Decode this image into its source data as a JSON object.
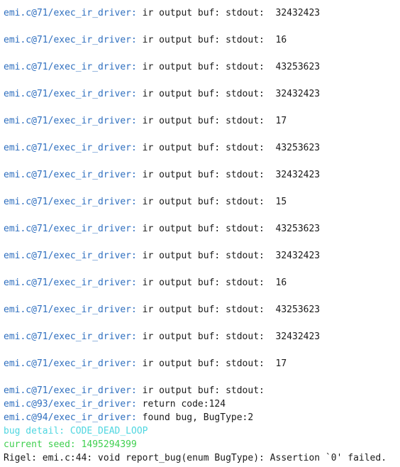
{
  "colors": {
    "source_prefix": "#2f6fbf",
    "message_text": "#1a1a1a",
    "bug_detail": "#4fd6e0",
    "current_seed": "#3fcf4f"
  },
  "output_lines": [
    {
      "source": "emi.c@71/exec_ir_driver:",
      "message": " ir output buf: stdout:  32432423"
    },
    {
      "source": "emi.c@71/exec_ir_driver:",
      "message": " ir output buf: stdout:  16"
    },
    {
      "source": "emi.c@71/exec_ir_driver:",
      "message": " ir output buf: stdout:  43253623"
    },
    {
      "source": "emi.c@71/exec_ir_driver:",
      "message": " ir output buf: stdout:  32432423"
    },
    {
      "source": "emi.c@71/exec_ir_driver:",
      "message": " ir output buf: stdout:  17"
    },
    {
      "source": "emi.c@71/exec_ir_driver:",
      "message": " ir output buf: stdout:  43253623"
    },
    {
      "source": "emi.c@71/exec_ir_driver:",
      "message": " ir output buf: stdout:  32432423"
    },
    {
      "source": "emi.c@71/exec_ir_driver:",
      "message": " ir output buf: stdout:  15"
    },
    {
      "source": "emi.c@71/exec_ir_driver:",
      "message": " ir output buf: stdout:  43253623"
    },
    {
      "source": "emi.c@71/exec_ir_driver:",
      "message": " ir output buf: stdout:  32432423"
    },
    {
      "source": "emi.c@71/exec_ir_driver:",
      "message": " ir output buf: stdout:  16"
    },
    {
      "source": "emi.c@71/exec_ir_driver:",
      "message": " ir output buf: stdout:  43253623"
    },
    {
      "source": "emi.c@71/exec_ir_driver:",
      "message": " ir output buf: stdout:  32432423"
    },
    {
      "source": "emi.c@71/exec_ir_driver:",
      "message": " ir output buf: stdout:  17"
    }
  ],
  "final_lines": [
    {
      "source": "emi.c@71/exec_ir_driver:",
      "message": " ir output buf: stdout:"
    },
    {
      "source": "emi.c@93/exec_ir_driver:",
      "message": " return code:124"
    },
    {
      "source": "emi.c@94/exec_ir_driver:",
      "message": " found bug, BugType:2"
    }
  ],
  "bug_detail": "bug detail: CODE_DEAD_LOOP",
  "current_seed": "current seed: 1495294399",
  "assertion": "Rigel: emi.c:44: void report_bug(enum BugType): Assertion `0' failed."
}
